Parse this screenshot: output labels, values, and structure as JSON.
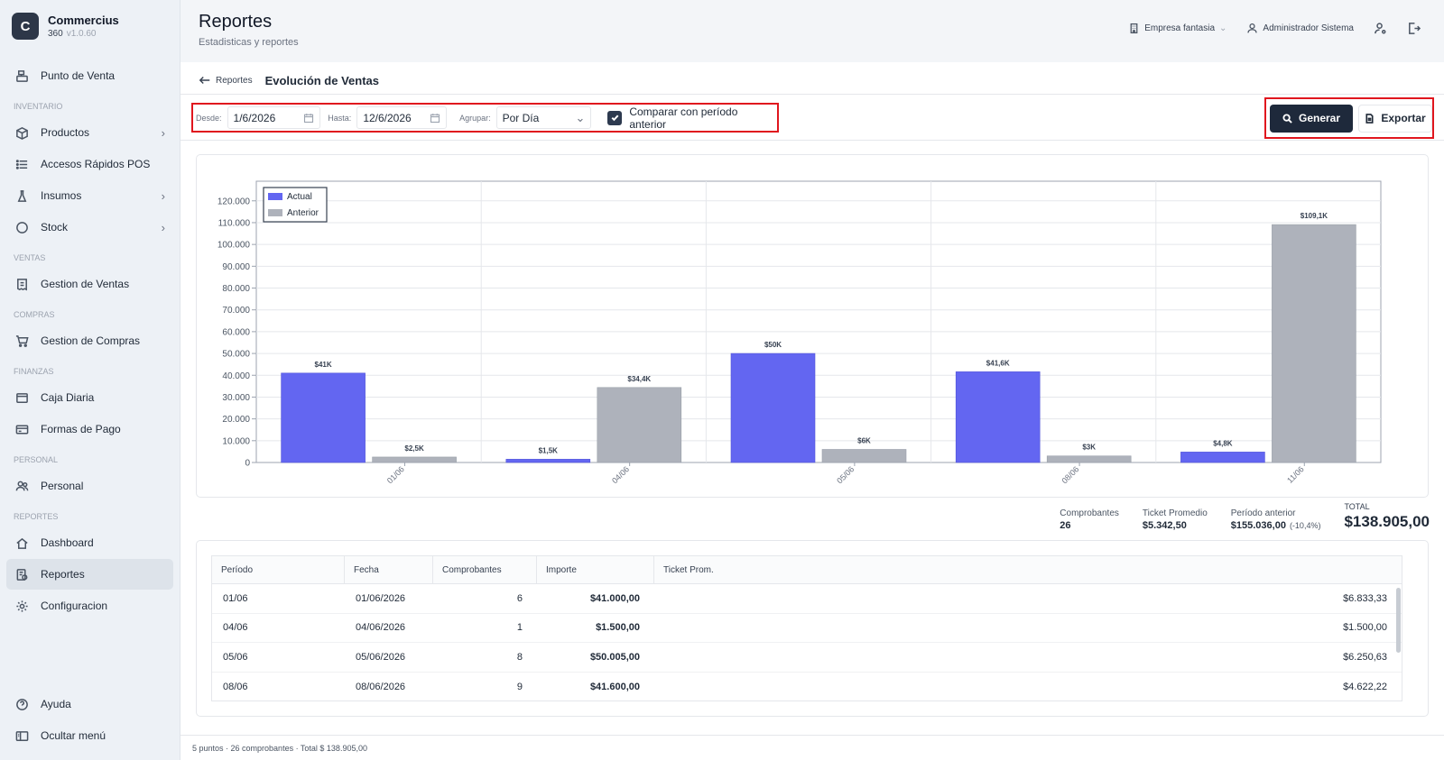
{
  "brand": {
    "name": "Commercius",
    "product": "360",
    "version": "v1.0.60",
    "logo_letter": "C"
  },
  "sidebar": {
    "top_item": {
      "label": "Punto de Venta",
      "icon": "cash-register-icon"
    },
    "sections": [
      {
        "title": "INVENTARIO",
        "items": [
          {
            "label": "Productos",
            "icon": "box-icon",
            "chevron": true
          },
          {
            "label": "Accesos Rápidos POS",
            "icon": "list-icon",
            "chevron": false
          },
          {
            "label": "Insumos",
            "icon": "flask-icon",
            "chevron": true
          },
          {
            "label": "Stock",
            "icon": "circle-icon",
            "chevron": true
          }
        ]
      },
      {
        "title": "VENTAS",
        "items": [
          {
            "label": "Gestion de Ventas",
            "icon": "receipt-icon"
          }
        ]
      },
      {
        "title": "COMPRAS",
        "items": [
          {
            "label": "Gestion de Compras",
            "icon": "cart-icon"
          }
        ]
      },
      {
        "title": "FINANZAS",
        "items": [
          {
            "label": "Caja Diaria",
            "icon": "wallet-icon"
          },
          {
            "label": "Formas de Pago",
            "icon": "card-icon"
          }
        ]
      },
      {
        "title": "PERSONAL",
        "items": [
          {
            "label": "Personal",
            "icon": "users-icon"
          }
        ]
      },
      {
        "title": "REPORTES",
        "items": [
          {
            "label": "Dashboard",
            "icon": "home-icon"
          },
          {
            "label": "Reportes",
            "icon": "report-icon",
            "active": true
          },
          {
            "label": "Configuracion",
            "icon": "gear-icon"
          }
        ]
      }
    ],
    "bottom": [
      {
        "label": "Ayuda",
        "icon": "help-icon"
      },
      {
        "label": "Ocultar menú",
        "icon": "sidebar-toggle-icon"
      }
    ]
  },
  "header": {
    "title": "Reportes",
    "subtitle": "Estadisticas y reportes",
    "company": "Empresa fantasia",
    "user": "Administrador Sistema"
  },
  "breadcrumb": {
    "back_label": "Reportes",
    "current": "Evolución de Ventas"
  },
  "filters": {
    "desde_label": "Desde:",
    "desde_value": "1/6/2026",
    "hasta_label": "Hasta:",
    "hasta_value": "12/6/2026",
    "agrupar_label": "Agrupar:",
    "agrupar_value": "Por Día",
    "compare_label": "Comparar con período anterior",
    "compare_checked": true
  },
  "actions": {
    "generate_label": "Generar",
    "export_label": "Exportar"
  },
  "colors": {
    "actual": "#6366f1",
    "anterior": "#aeb2bb",
    "highlight": "#e0161e",
    "primary": "#1e293b"
  },
  "chart_data": {
    "type": "bar",
    "x": [
      "01/06",
      "04/06",
      "05/06",
      "08/06",
      "11/06"
    ],
    "series": [
      {
        "name": "Actual",
        "values": [
          41000,
          1500,
          50005,
          41600,
          4800
        ],
        "labels": [
          "$41K",
          "$1,5K",
          "$50K",
          "$41,6K",
          "$4,8K"
        ]
      },
      {
        "name": "Anterior",
        "values": [
          2500,
          34400,
          6000,
          3000,
          109100
        ],
        "labels": [
          "$2,5K",
          "$34,4K",
          "$6K",
          "$3K",
          "$109,1K"
        ]
      }
    ],
    "ylim": [
      0,
      129000
    ],
    "yticks": [
      "0",
      "10.000",
      "20.000",
      "30.000",
      "40.000",
      "50.000",
      "60.000",
      "70.000",
      "80.000",
      "90.000",
      "100.000",
      "110.000",
      "120.000"
    ],
    "legend": "top-left",
    "grid": true
  },
  "summary": {
    "comprobantes_label": "Comprobantes",
    "comprobantes_value": "26",
    "ticket_label": "Ticket Promedio",
    "ticket_value": "$5.342,50",
    "anterior_label": "Período anterior",
    "anterior_value": "$155.036,00",
    "anterior_pct": "(-10,4%)",
    "total_label": "TOTAL",
    "total_value": "$138.905,00"
  },
  "table": {
    "columns": [
      "Período",
      "Fecha",
      "Comprobantes",
      "Importe",
      "Ticket Prom."
    ],
    "rows": [
      [
        "01/06",
        "01/06/2026",
        "6",
        "$41.000,00",
        "$6.833,33"
      ],
      [
        "04/06",
        "04/06/2026",
        "1",
        "$1.500,00",
        "$1.500,00"
      ],
      [
        "05/06",
        "05/06/2026",
        "8",
        "$50.005,00",
        "$6.250,63"
      ],
      [
        "08/06",
        "08/06/2026",
        "9",
        "$41.600,00",
        "$4.622,22"
      ]
    ]
  },
  "footer": {
    "text": "5 puntos · 26 comprobantes · Total $ 138.905,00"
  }
}
